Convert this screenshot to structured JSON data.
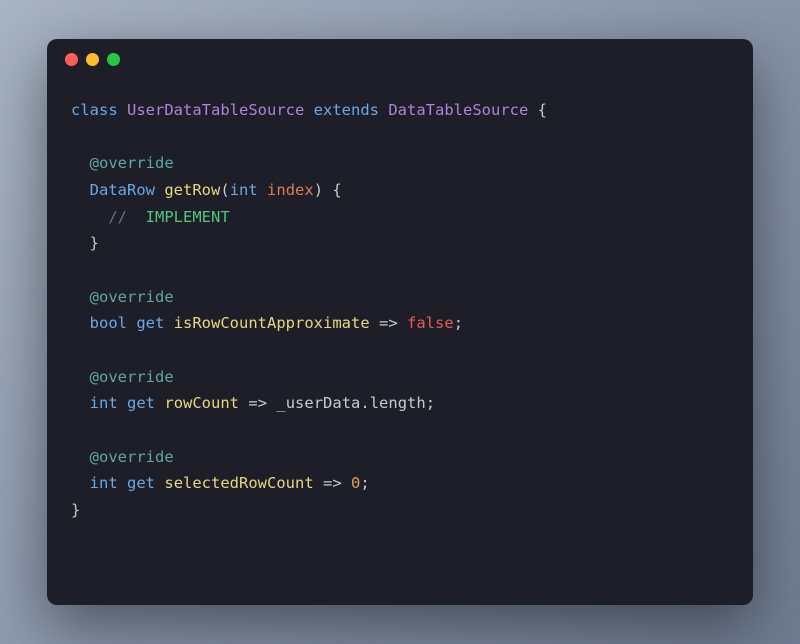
{
  "code": {
    "line1": {
      "kw_class": "class",
      "class_name": "UserDataTableSource",
      "kw_extends": "extends",
      "ext_name": "DataTableSource",
      "brace_open": " {"
    },
    "line3": {
      "annotation": "@override"
    },
    "line4": {
      "type": "DataRow",
      "method": "getRow",
      "paren_open": "(",
      "param_type": "int",
      "param_name": "index",
      "paren_close": ") {"
    },
    "line5": {
      "comment_slashes": "// ",
      "comment_text": " IMPLEMENT"
    },
    "line6": {
      "brace_close": "}"
    },
    "line8": {
      "annotation": "@override"
    },
    "line9": {
      "type": "bool",
      "kw_get": "get",
      "prop": "isRowCountApproximate",
      "arrow": "=>",
      "value": "false",
      "semi": ";"
    },
    "line11": {
      "annotation": "@override"
    },
    "line12": {
      "type": "int",
      "kw_get": "get",
      "prop": "rowCount",
      "arrow": "=>",
      "field": "_userData",
      "dot": ".",
      "length": "length",
      "semi": ";"
    },
    "line14": {
      "annotation": "@override"
    },
    "line15": {
      "type": "int",
      "kw_get": "get",
      "prop": "selectedRowCount",
      "arrow": "=>",
      "value": "0",
      "semi": ";"
    },
    "line16": {
      "brace_close": "}"
    }
  }
}
